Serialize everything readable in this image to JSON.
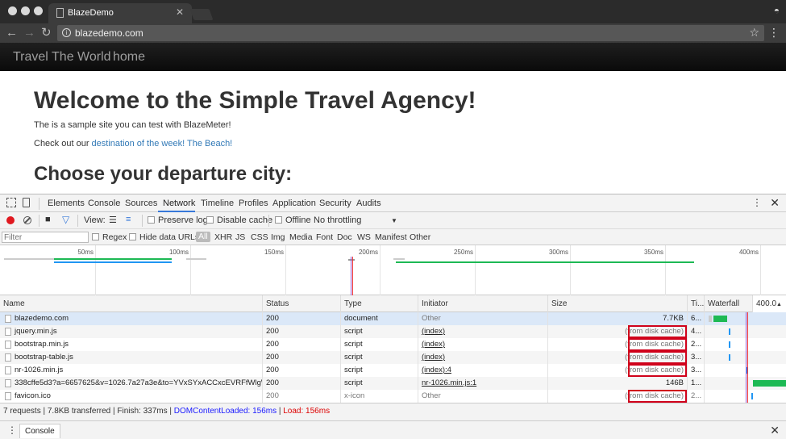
{
  "browser": {
    "tab_title": "BlazeDemo",
    "url": "blazedemo.com",
    "icons": [
      "back-icon",
      "forward-icon",
      "reload-icon",
      "info-icon",
      "star-icon",
      "menu-icon",
      "incognito-icon"
    ]
  },
  "site": {
    "nav_brand": "Travel The World",
    "nav_home": "home",
    "heading": "Welcome to the Simple Travel Agency!",
    "intro": "The is a sample site you can test with BlazeMeter!",
    "checkout_prefix": "Check out our ",
    "checkout_link": "destination of the week! The Beach!",
    "subheading": "Choose your departure city:"
  },
  "devtools": {
    "tabs": [
      "Elements",
      "Console",
      "Sources",
      "Network",
      "Timeline",
      "Profiles",
      "Application",
      "Security",
      "Audits"
    ],
    "active_tab": "Network",
    "toolbar": {
      "view_label": "View:",
      "preserve_log": "Preserve log",
      "disable_cache": "Disable cache",
      "offline": "Offline",
      "throttling": "No throttling"
    },
    "filter": {
      "placeholder": "Filter",
      "regex": "Regex",
      "hide_data_urls": "Hide data URLs",
      "types": [
        "All",
        "XHR",
        "JS",
        "CSS",
        "Img",
        "Media",
        "Font",
        "Doc",
        "WS",
        "Manifest",
        "Other"
      ]
    },
    "overview_ticks": [
      "50ms",
      "100ms",
      "150ms",
      "200ms",
      "250ms",
      "300ms",
      "350ms",
      "400ms"
    ],
    "columns": [
      "Name",
      "Status",
      "Type",
      "Initiator",
      "Size",
      "Ti...",
      "Waterfall",
      "400.0"
    ],
    "requests": [
      {
        "name": "blazedemo.com",
        "status": "200",
        "type": "document",
        "initiator": "Other",
        "size": "7.7KB",
        "time": "6...",
        "cached": false,
        "initiator_link": false
      },
      {
        "name": "jquery.min.js",
        "status": "200",
        "type": "script",
        "initiator": "(index)",
        "size": "(from disk cache)",
        "time": "4...",
        "cached": true,
        "initiator_link": true
      },
      {
        "name": "bootstrap.min.js",
        "status": "200",
        "type": "script",
        "initiator": "(index)",
        "size": "(from disk cache)",
        "time": "2...",
        "cached": true,
        "initiator_link": true
      },
      {
        "name": "bootstrap-table.js",
        "status": "200",
        "type": "script",
        "initiator": "(index)",
        "size": "(from disk cache)",
        "time": "3...",
        "cached": true,
        "initiator_link": true
      },
      {
        "name": "nr-1026.min.js",
        "status": "200",
        "type": "script",
        "initiator": "(index):4",
        "size": "(from disk cache)",
        "time": "3...",
        "cached": true,
        "initiator_link": true
      },
      {
        "name": "338cffe5d3?a=6657625&v=1026.7a27a3e&to=YVxSYxACCxcEVRFfWlgWcVQ...",
        "status": "200",
        "type": "script",
        "initiator": "nr-1026.min.js:1",
        "size": "146B",
        "time": "1...",
        "cached": false,
        "initiator_link": true
      },
      {
        "name": "favicon.ico",
        "status": "200",
        "type": "x-icon",
        "initiator": "Other",
        "size": "(from disk cache)",
        "time": "2...",
        "cached": true,
        "initiator_link": false
      }
    ],
    "summary": {
      "requests": "7 requests",
      "transferred": "7.8KB transferred",
      "finish": "Finish: 337ms",
      "dom_content_loaded": "DOMContentLoaded: 156ms",
      "load": "Load: 156ms"
    },
    "drawer_tab": "Console"
  },
  "colors": {
    "highlight_box": "#d0021b",
    "accent": "#3879d9",
    "waterfall_green": "#1db954",
    "waterfall_blue": "#2196f3"
  }
}
